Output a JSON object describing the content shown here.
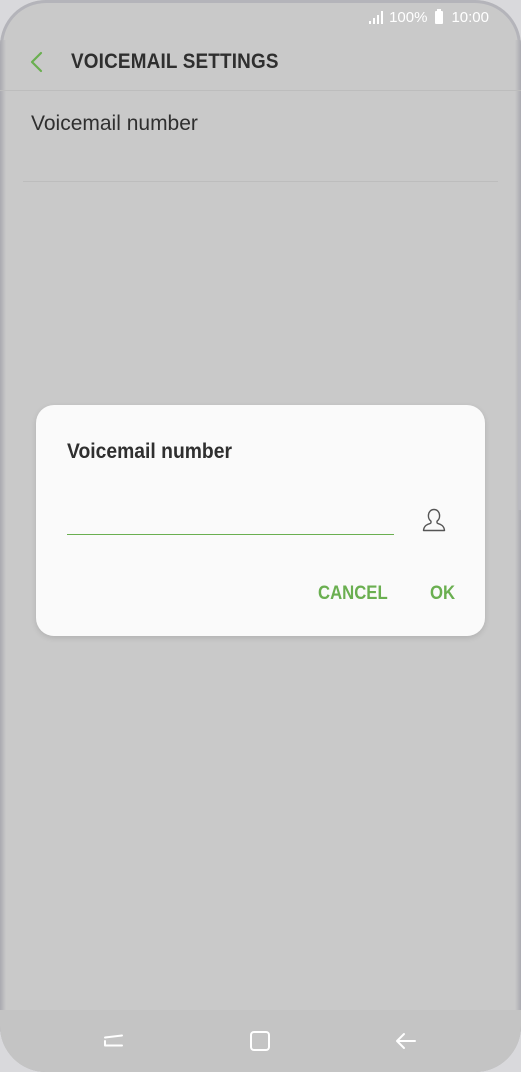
{
  "status_bar": {
    "battery": "100%",
    "time": "10:00"
  },
  "app_bar": {
    "title": "VOICEMAIL SETTINGS",
    "back_icon": "chevron-left-icon"
  },
  "list": {
    "items": [
      {
        "label": "Voicemail number"
      }
    ]
  },
  "dialog": {
    "title": "Voicemail number",
    "input_value": "",
    "input_placeholder": "",
    "contact_icon": "contact-person-icon",
    "cancel_label": "CANCEL",
    "ok_label": "OK"
  },
  "nav_bar": {
    "icons": [
      "recents-icon",
      "home-icon",
      "back-icon"
    ]
  },
  "colors": {
    "accent": "#6aaf50",
    "text": "#2f2f2f",
    "dim_background": "#c9c9c9",
    "dialog_background": "#fafafa"
  }
}
